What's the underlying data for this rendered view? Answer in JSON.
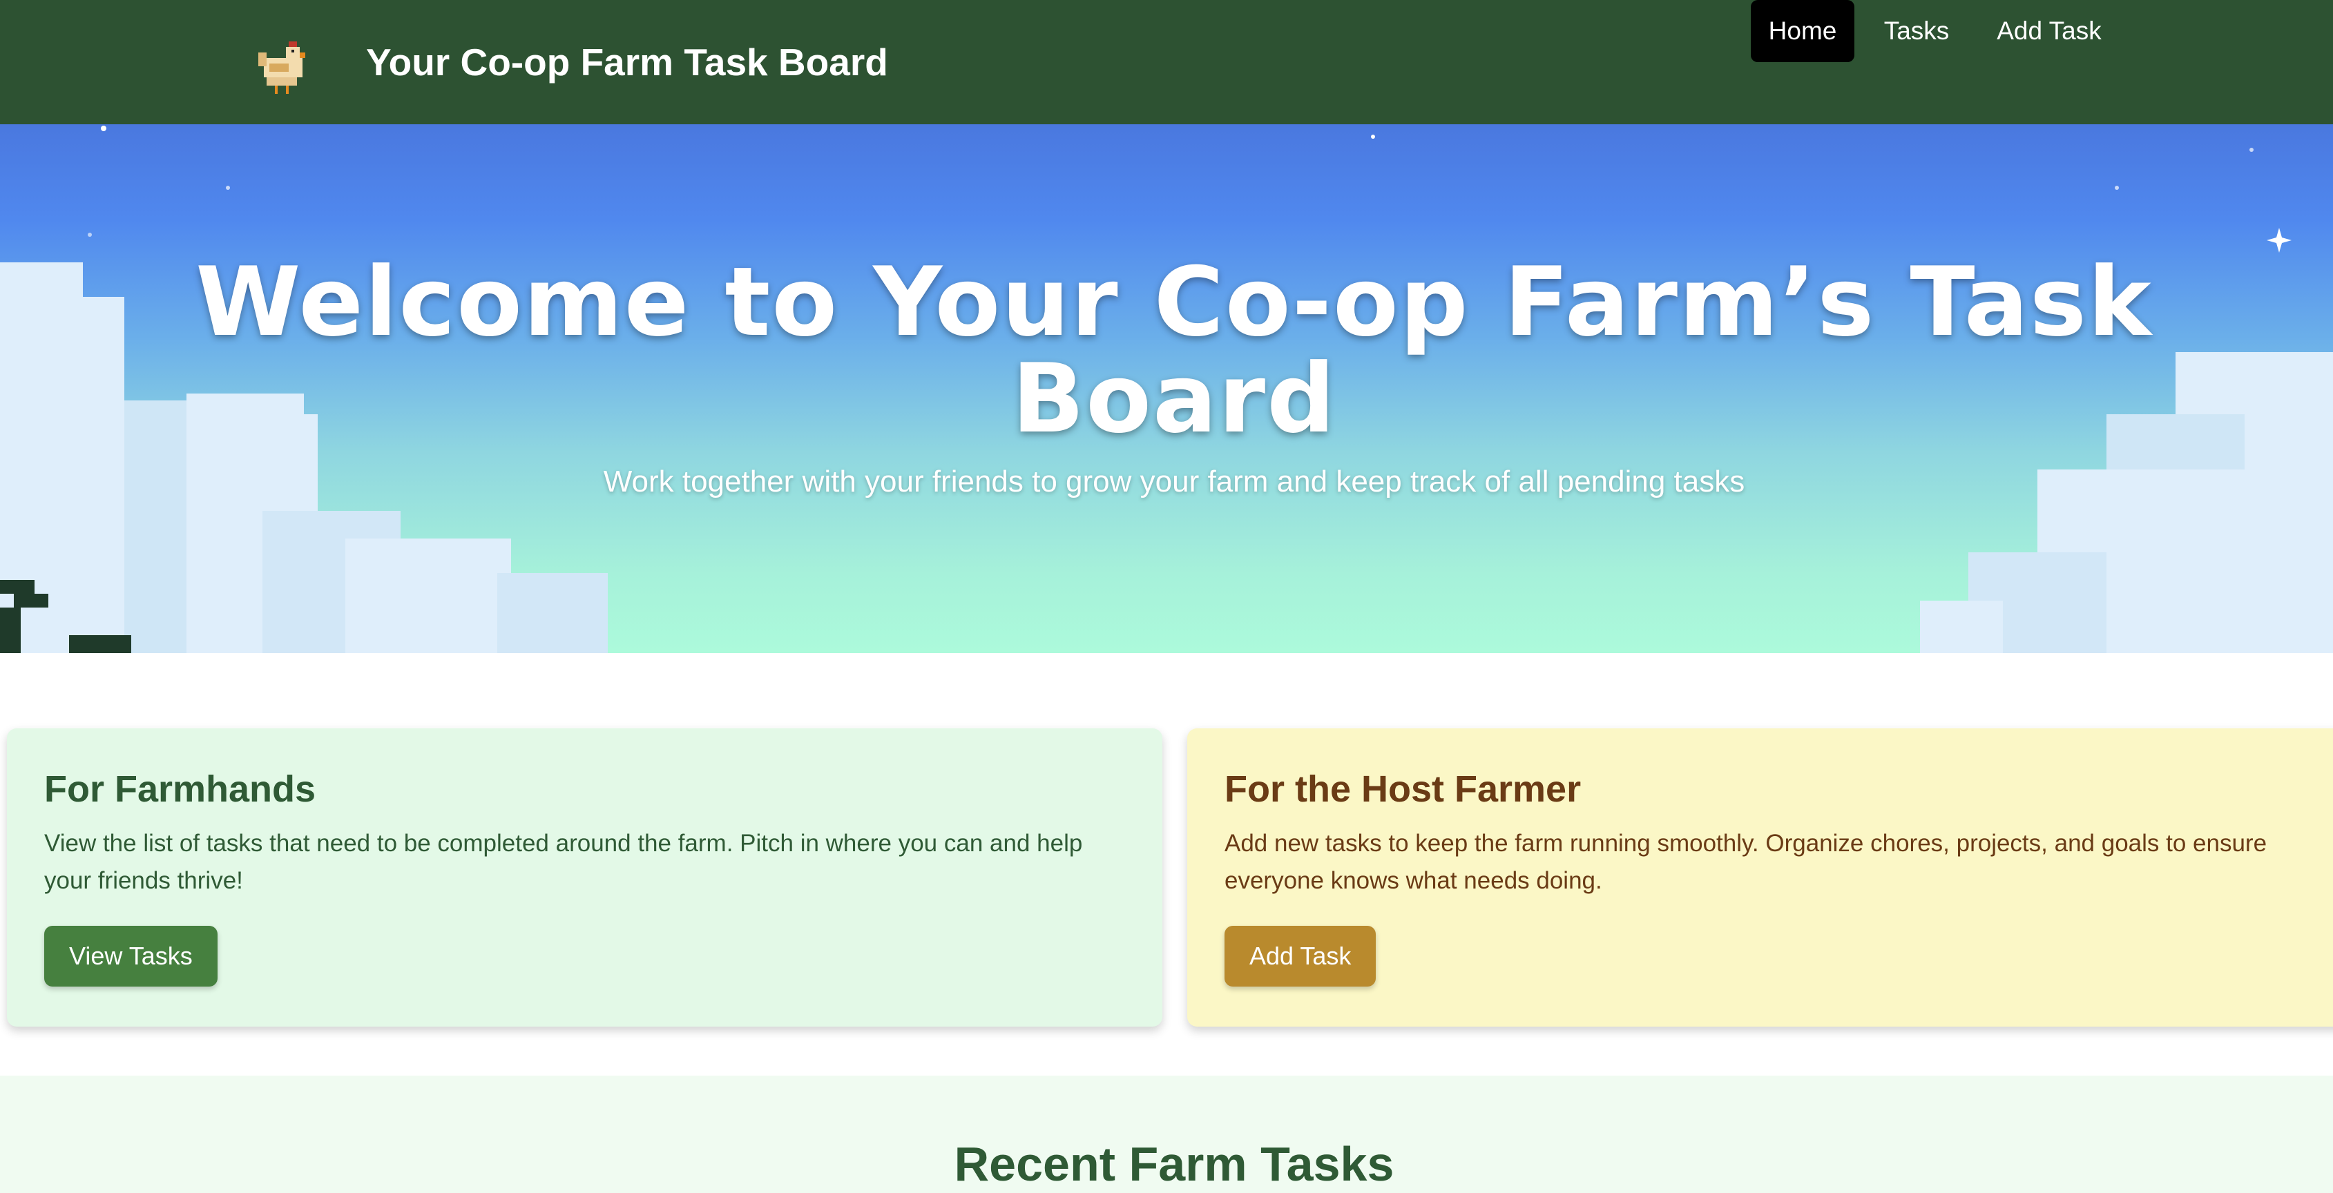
{
  "header": {
    "logo_icon": "chicken-icon",
    "title": "Your Co-op Farm Task Board",
    "nav": [
      {
        "label": "Home",
        "active": true
      },
      {
        "label": "Tasks",
        "active": false
      },
      {
        "label": "Add Task",
        "active": false
      }
    ]
  },
  "hero": {
    "title": "Welcome to Your Co-op Farm’s Task Board",
    "subtitle": "Work together with your friends to grow your farm and keep track of all pending tasks"
  },
  "cards": {
    "farmhands": {
      "title": "For Farmhands",
      "text": "View the list of tasks that need to be completed around the farm. Pitch in where you can and help your friends thrive!",
      "button": "View Tasks"
    },
    "host": {
      "title": "For the Host Farmer",
      "text": "Add new tasks to keep the farm running smoothly. Organize chores, projects, and goals to ensure everyone knows what needs doing.",
      "button": "Add Task"
    }
  },
  "recent": {
    "title": "Recent Farm Tasks"
  },
  "colors": {
    "header_bg": "#2d5232",
    "nav_active_bg": "#000000",
    "farmhands_card_bg": "#e3f9e7",
    "host_card_bg": "#fbf7c6",
    "view_button": "#46803f",
    "add_button": "#b98a2d"
  }
}
